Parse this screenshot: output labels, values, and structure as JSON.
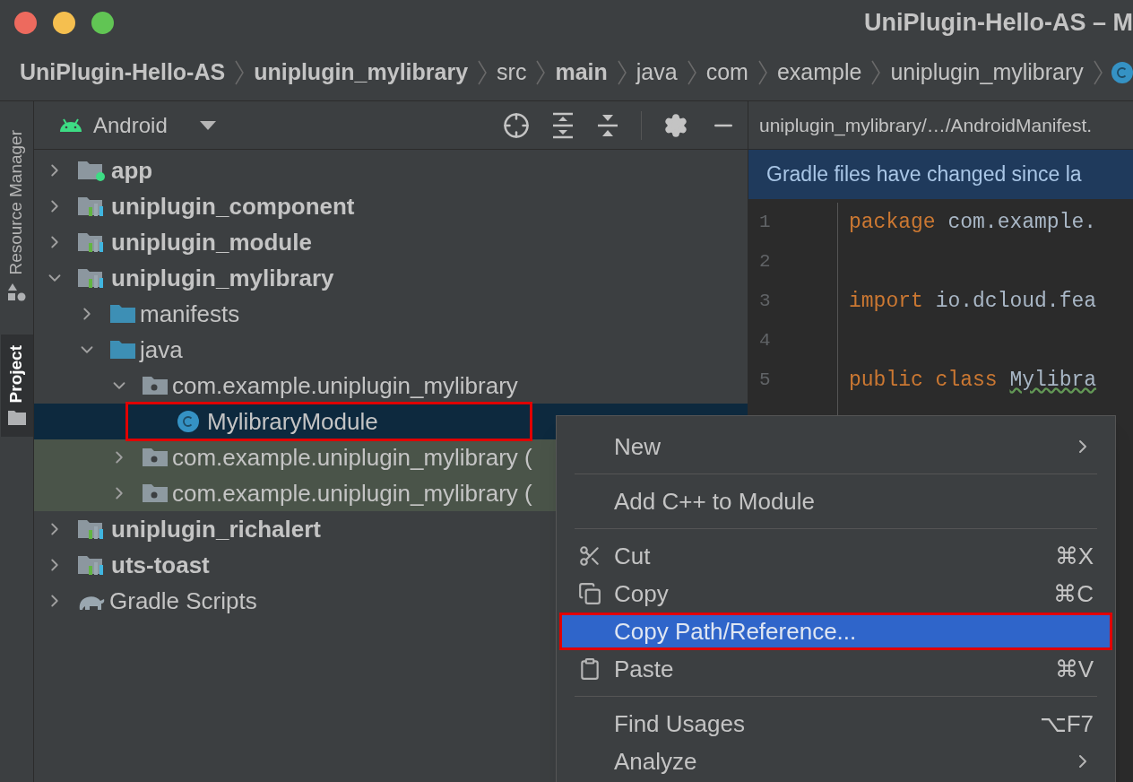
{
  "window": {
    "title": "UniPlugin-Hello-AS – M"
  },
  "breadcrumbs": [
    {
      "label": "UniPlugin-Hello-AS",
      "kind": "project"
    },
    {
      "label": "uniplugin_mylibrary",
      "kind": "module"
    },
    {
      "label": "src",
      "kind": "folder"
    },
    {
      "label": "main",
      "kind": "sourceset"
    },
    {
      "label": "java",
      "kind": "folder"
    },
    {
      "label": "com",
      "kind": "folder"
    },
    {
      "label": "example",
      "kind": "folder"
    },
    {
      "label": "uniplugin_mylibrary",
      "kind": "folder"
    },
    {
      "kind": "class"
    }
  ],
  "tool_strip": [
    {
      "label": "Resource Manager",
      "kind": "resources",
      "selected": false
    },
    {
      "label": "Project",
      "kind": "project",
      "selected": true
    }
  ],
  "project_panel": {
    "view": "Android",
    "tree": [
      {
        "label": "app",
        "kind": "app",
        "expanded": false
      },
      {
        "label": "uniplugin_component",
        "kind": "module",
        "expanded": false
      },
      {
        "label": "uniplugin_module",
        "kind": "module",
        "expanded": false
      },
      {
        "label": "uniplugin_mylibrary",
        "kind": "module",
        "expanded": true,
        "children": [
          {
            "label": "manifests",
            "kind": "folder",
            "expanded": false
          },
          {
            "label": "java",
            "kind": "folder",
            "expanded": true,
            "children": [
              {
                "label": "com.example.uniplugin_mylibrary",
                "kind": "package",
                "expanded": true,
                "children": [
                  {
                    "label": "MylibraryModule",
                    "kind": "class",
                    "selected": true,
                    "annotated": true
                  }
                ]
              },
              {
                "label": "com.example.uniplugin_mylibrary (",
                "kind": "package",
                "expanded": false,
                "highlighted": true
              },
              {
                "label": "com.example.uniplugin_mylibrary (",
                "kind": "package",
                "expanded": false,
                "highlighted": true
              }
            ]
          }
        ]
      },
      {
        "label": "uniplugin_richalert",
        "kind": "module",
        "expanded": false
      },
      {
        "label": "uts-toast",
        "kind": "module",
        "expanded": false
      },
      {
        "label": "Gradle Scripts",
        "kind": "gradle",
        "expanded": false
      }
    ]
  },
  "editor": {
    "tab": "uniplugin_mylibrary/…/AndroidManifest.",
    "banner": "Gradle files have changed since la",
    "lines": [
      {
        "number": "1",
        "keyword": "package",
        "rest": "com.example."
      },
      {
        "number": "2"
      },
      {
        "number": "3",
        "keyword": "import",
        "rest": "io.dcloud.fea"
      },
      {
        "number": "4"
      },
      {
        "number": "5",
        "keyword": "public class",
        "rest": "Mylibra"
      }
    ]
  },
  "context_menu": [
    {
      "kind": "item",
      "label": "New",
      "submenu": true
    },
    {
      "kind": "separator"
    },
    {
      "kind": "item",
      "label": "Add C++ to Module",
      "selected": false
    },
    {
      "kind": "separator"
    },
    {
      "kind": "cut",
      "label": "Cut",
      "shortcut": "⌘X",
      "selected": false
    },
    {
      "kind": "copy",
      "label": "Copy",
      "shortcut": "⌘C",
      "selected": false
    },
    {
      "kind": "item",
      "label": "Copy Path/Reference...",
      "selected": true,
      "annotated": true
    },
    {
      "kind": "paste",
      "label": "Paste",
      "shortcut": "⌘V",
      "selected": false
    },
    {
      "kind": "separator"
    },
    {
      "kind": "item",
      "label": "Find Usages",
      "shortcut": "⌥F7",
      "selected": false
    },
    {
      "kind": "item",
      "label": "Analyze",
      "submenu": true,
      "selected": false
    }
  ]
}
